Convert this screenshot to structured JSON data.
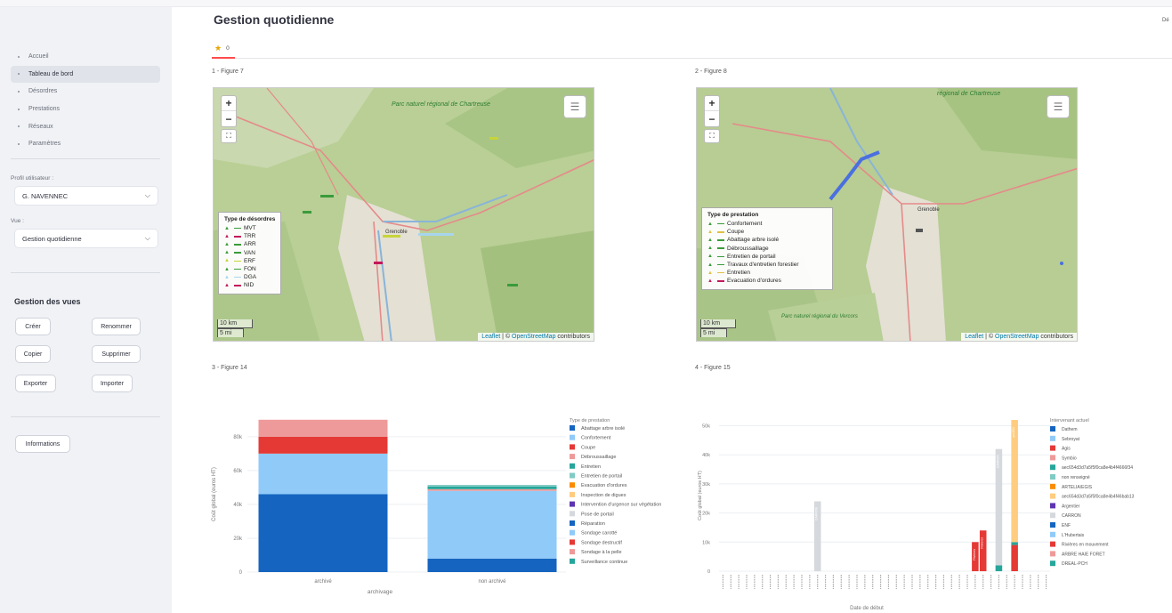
{
  "page": {
    "title": "Gestion quotidienne",
    "header_right": "Dé"
  },
  "nav": [
    {
      "label": "Accueil",
      "active": false
    },
    {
      "label": "Tableau de bord",
      "active": true
    },
    {
      "label": "Désordres",
      "active": false
    },
    {
      "label": "Prestations",
      "active": false
    },
    {
      "label": "Réseaux",
      "active": false
    },
    {
      "label": "Paramètres",
      "active": false
    }
  ],
  "profile": {
    "label": "Profil utilisateur :",
    "value": "G. NAVENNEC"
  },
  "view": {
    "label": "Vue :",
    "value": "Gestion quotidienne"
  },
  "views_section": {
    "title": "Gestion des vues",
    "buttons": [
      "Créer",
      "Renommer",
      "Copier",
      "Supprimer",
      "Exporter",
      "Importer"
    ]
  },
  "info_button": "Informations",
  "tab": {
    "icon": "star-icon",
    "label": "0"
  },
  "figures": [
    {
      "title": "1 - Figure 7"
    },
    {
      "title": "2 - Figure 8"
    },
    {
      "title": "3 - Figure 14"
    },
    {
      "title": "4 - Figure 15"
    }
  ],
  "map1": {
    "legend_title": "Type de désordres",
    "legend": [
      {
        "label": "MVT",
        "color": "#3b9b3b"
      },
      {
        "label": "TRR",
        "color": "#c2185b"
      },
      {
        "label": "ARR",
        "color": "#3b9b3b"
      },
      {
        "label": "VAN",
        "color": "#3b9b3b"
      },
      {
        "label": "ERF",
        "color": "#c7d43a"
      },
      {
        "label": "FON",
        "color": "#3b9b3b"
      },
      {
        "label": "DGA",
        "color": "#a7d5ee"
      },
      {
        "label": "NID",
        "color": "#c2185b"
      }
    ],
    "scale": [
      "10 km",
      "5 mi"
    ],
    "place_labels": [
      "Parc naturel régional de Chartreuse",
      "Grenoble"
    ]
  },
  "map2": {
    "legend_title": "Type de prestation",
    "legend": [
      {
        "label": "Confortement",
        "color": "#3b9b3b"
      },
      {
        "label": "Coupe",
        "color": "#e0c040"
      },
      {
        "label": "Abattage arbre isolé",
        "color": "#3b9b3b"
      },
      {
        "label": "Débroussaillage",
        "color": "#3b9b3b"
      },
      {
        "label": "Entretien de portail",
        "color": "#3b9b3b"
      },
      {
        "label": "Travaux d'entretien forestier",
        "color": "#3b9b3b"
      },
      {
        "label": "Entretien",
        "color": "#e0c040"
      },
      {
        "label": "Evacuation d'ordures",
        "color": "#c2185b"
      }
    ],
    "scale": [
      "10 km",
      "5 mi"
    ],
    "place_labels": [
      "régional de Chartreuse",
      "Grenoble",
      "Parc naturel régional du Vercors"
    ]
  },
  "attribution": {
    "leaflet": "Leaflet",
    "sep": " | © ",
    "osm": "OpenStreetMap",
    "rest": " contributors"
  },
  "chart_data": [
    {
      "type": "bar",
      "stacked": true,
      "xlabel": "archivage",
      "ylabel": "Coût global (euros HT)",
      "categories": [
        "archivé",
        "non archivé"
      ],
      "yticks": [
        "0",
        "20k",
        "40k",
        "60k",
        "80k"
      ],
      "ylim": [
        0,
        92000
      ],
      "legend_title": "Type de prestation",
      "series": [
        {
          "name": "Abattage arbre isolé",
          "color": "#1565c0",
          "values": [
            46000,
            8000
          ]
        },
        {
          "name": "Confortement",
          "color": "#90caf9",
          "values": [
            24000,
            40000
          ]
        },
        {
          "name": "Coupe",
          "color": "#e53935",
          "values": [
            10000,
            0
          ]
        },
        {
          "name": "Débroussaillage",
          "color": "#ef9a9a",
          "values": [
            10000,
            1000
          ]
        },
        {
          "name": "Entretien",
          "color": "#26a69a",
          "values": [
            0,
            1500
          ]
        },
        {
          "name": "Entretien de portail",
          "color": "#80cbc4",
          "values": [
            0,
            1000
          ]
        },
        {
          "name": "Evacuation d'ordures",
          "color": "#fb8c00",
          "values": [
            0,
            0
          ]
        },
        {
          "name": "Inspection de digues",
          "color": "#ffcc80",
          "values": [
            0,
            0
          ]
        },
        {
          "name": "Intervention d'urgence sur végétation",
          "color": "#5e35b1",
          "values": [
            0,
            0
          ]
        },
        {
          "name": "Pose de portail",
          "color": "#d5d8dc",
          "values": [
            0,
            0
          ]
        },
        {
          "name": "Réparation",
          "color": "#1565c0",
          "values": [
            0,
            0
          ]
        },
        {
          "name": "Sondage carotté",
          "color": "#90caf9",
          "values": [
            0,
            0
          ]
        },
        {
          "name": "Sondage destructif",
          "color": "#e53935",
          "values": [
            0,
            0
          ]
        },
        {
          "name": "Sondage à la pelle",
          "color": "#ef9a9a",
          "values": [
            0,
            0
          ]
        },
        {
          "name": "Surveillance continue",
          "color": "#26a69a",
          "values": [
            0,
            0
          ]
        }
      ]
    },
    {
      "type": "bar",
      "stacked": true,
      "xlabel": "Date de début",
      "ylabel": "Coût global (euros HT)",
      "yticks": [
        "0",
        "10k",
        "20k",
        "30k",
        "40k",
        "50k"
      ],
      "ylim": [
        0,
        52000
      ],
      "n_categories": 42,
      "legend_title": "Intervenant actuel",
      "legend": [
        {
          "name": "Dathem",
          "color": "#1565c0"
        },
        {
          "name": "Sebroyat",
          "color": "#90caf9"
        },
        {
          "name": "Agis",
          "color": "#e53935"
        },
        {
          "name": "Symbio",
          "color": "#ef9a9a"
        },
        {
          "name": "aec654d3d7a5f5f0ca8e4b4f4666f34",
          "color": "#26a69a"
        },
        {
          "name": "non renseigné",
          "color": "#80cbc4"
        },
        {
          "name": "ARTELIA/EGIS",
          "color": "#fb8c00"
        },
        {
          "name": "aec654d3d7a5f5f0ca8e4b4f46bab13",
          "color": "#ffcc80"
        },
        {
          "name": "Argentier",
          "color": "#5e35b1"
        },
        {
          "name": "CARRON",
          "color": "#d5d8dc"
        },
        {
          "name": "ENF",
          "color": "#1565c0"
        },
        {
          "name": "L'Hubertais",
          "color": "#90caf9"
        },
        {
          "name": "Rivières en mouvement",
          "color": "#e53935"
        },
        {
          "name": "ARBRE HAIE FORET",
          "color": "#ef9a9a"
        },
        {
          "name": "DREAL-PCH",
          "color": "#26a69a"
        }
      ],
      "bars": [
        {
          "index": 12,
          "segments": [
            {
              "color": "#d5d8dc",
              "value": 24000
            }
          ],
          "label": "CARRON"
        },
        {
          "index": 32,
          "segments": [
            {
              "color": "#e53935",
              "value": 10000
            }
          ],
          "label": "Rivières"
        },
        {
          "index": 33,
          "segments": [
            {
              "color": "#e53935",
              "value": 14000
            }
          ],
          "label": "Rivières"
        },
        {
          "index": 35,
          "segments": [
            {
              "color": "#26a69a",
              "value": 2000
            },
            {
              "color": "#d5d8dc",
              "value": 40000
            }
          ],
          "label": "CARRON"
        },
        {
          "index": 37,
          "segments": [
            {
              "color": "#e53935",
              "value": 9000
            },
            {
              "color": "#26a69a",
              "value": 1000
            },
            {
              "color": "#ffcc80",
              "value": 42000
            }
          ],
          "label": "aec654"
        }
      ]
    }
  ]
}
